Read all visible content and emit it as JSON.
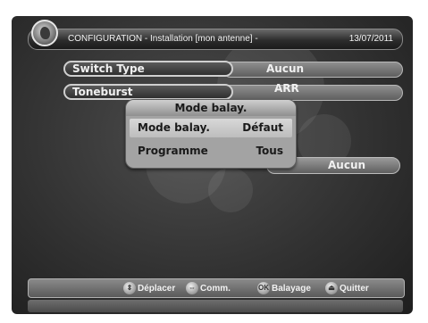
{
  "header": {
    "title": "CONFIGURATION - Installation  [mon antenne] -",
    "date": "13/07/2011",
    "logo_icon": "satellite-dish-logo-icon"
  },
  "settings": [
    {
      "label": "Switch Type",
      "value": "Aucun"
    },
    {
      "label": "Toneburst",
      "value": "ARR"
    }
  ],
  "hidden_row_value": "Aucun",
  "popup": {
    "title": "Mode balay.",
    "rows": [
      {
        "label": "Mode balay.",
        "value": "Défaut",
        "selected": true
      },
      {
        "label": "Programme",
        "value": "Tous",
        "selected": false
      }
    ]
  },
  "footer": {
    "hints": [
      {
        "icon": "up-down-arrows-icon",
        "label": "Déplacer"
      },
      {
        "icon": "left-right-arrows-icon",
        "label": "Comm."
      },
      {
        "icon": "ok-button-icon",
        "icon_text": "OK",
        "label": "Balayage"
      },
      {
        "icon": "exit-button-icon",
        "label": "Quitter"
      }
    ]
  },
  "colors": {
    "background": "#323232",
    "popup": "#a3a3a3",
    "text_light": "#f0f0f0",
    "text_dark": "#1a1a1a"
  }
}
